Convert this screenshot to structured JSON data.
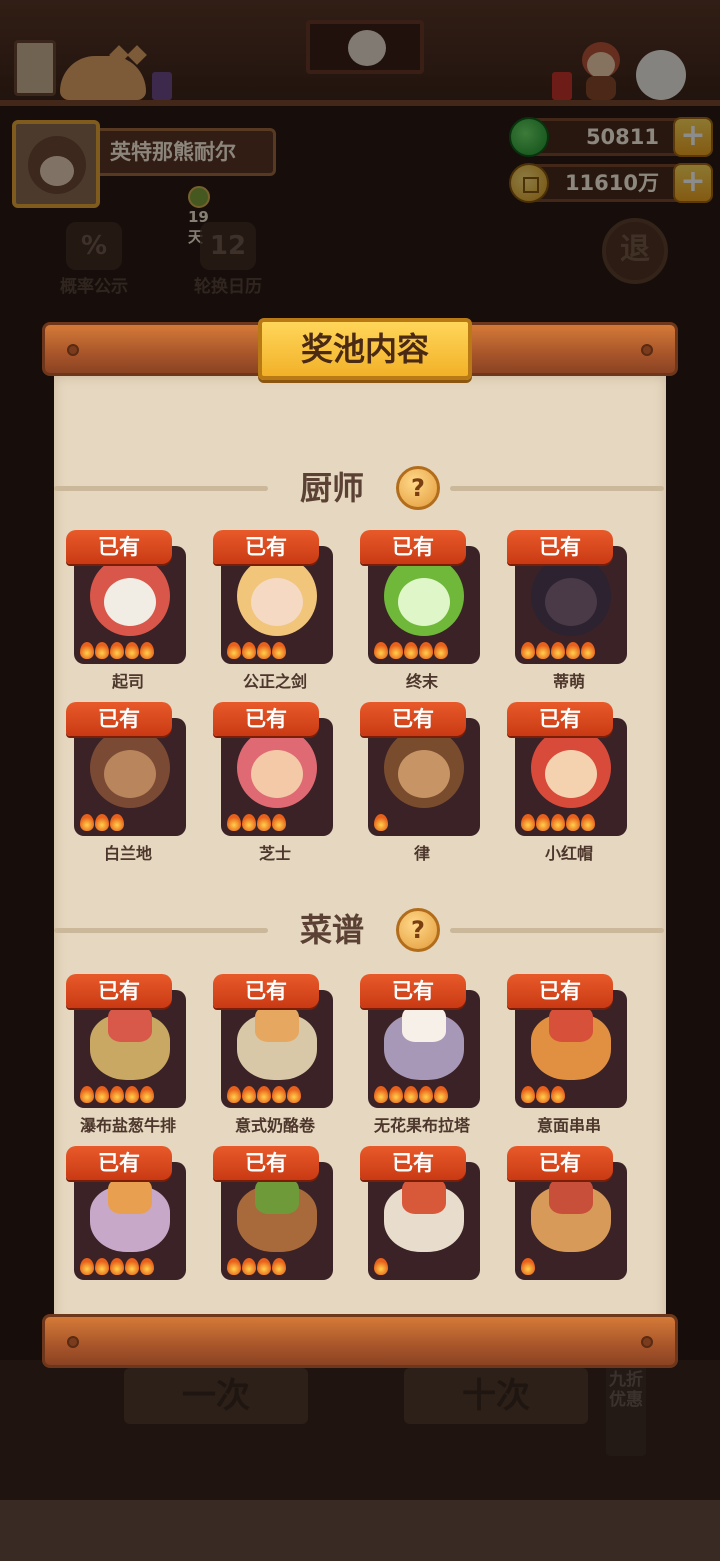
{
  "player": {
    "name": "英特那熊耐尔",
    "days": "19天"
  },
  "currency": {
    "jade": "50811",
    "gold": "11610万"
  },
  "background": {
    "probability_label": "概率公示",
    "calendar_label": "轮换日历",
    "back_label": "退",
    "draw_one_label": "一次",
    "draw_ten_label": "十次",
    "discount_label": "九折优惠"
  },
  "popup": {
    "title": "奖池内容",
    "chef_section": "厨师",
    "recipe_section": "菜谱",
    "help_symbol": "?",
    "owned_label": "已有",
    "chefs": [
      {
        "name": "起司",
        "stars": 5,
        "color": "#d9574a",
        "accent": "#f2ede4"
      },
      {
        "name": "公正之剑",
        "stars": 4,
        "color": "#f1c57a",
        "accent": "#f6d9c2"
      },
      {
        "name": "终末",
        "stars": 5,
        "color": "#6fb83a",
        "accent": "#dff6c8"
      },
      {
        "name": "蒂萌",
        "stars": 5,
        "color": "#2c2230",
        "accent": "#4a3a48"
      },
      {
        "name": "白兰地",
        "stars": 3,
        "color": "#7a4a34",
        "accent": "#b8855c"
      },
      {
        "name": "芝士",
        "stars": 4,
        "color": "#e06a74",
        "accent": "#f3c9a8"
      },
      {
        "name": "律",
        "stars": 1,
        "color": "#7a4c2e",
        "accent": "#c79466"
      },
      {
        "name": "小红帽",
        "stars": 5,
        "color": "#d84a3a",
        "accent": "#f4d2b0"
      }
    ],
    "recipes": [
      {
        "name": "瀑布盐葱牛排",
        "stars": 5,
        "color": "#c8a862",
        "accent": "#d8584a"
      },
      {
        "name": "意式奶酪卷",
        "stars": 5,
        "color": "#d8c8a8",
        "accent": "#e6a860"
      },
      {
        "name": "无花果布拉塔",
        "stars": 5,
        "color": "#a898b8",
        "accent": "#f6f0e8"
      },
      {
        "name": "意面串串",
        "stars": 3,
        "color": "#e09040",
        "accent": "#d6503a"
      },
      {
        "name": "",
        "stars": 5,
        "color": "#c8a8c8",
        "accent": "#e8a050"
      },
      {
        "name": "",
        "stars": 4,
        "color": "#a86a3a",
        "accent": "#6e9a3a"
      },
      {
        "name": "",
        "stars": 1,
        "color": "#e8dccc",
        "accent": "#d8583a"
      },
      {
        "name": "",
        "stars": 1,
        "color": "#d89a58",
        "accent": "#c8503a"
      }
    ]
  }
}
